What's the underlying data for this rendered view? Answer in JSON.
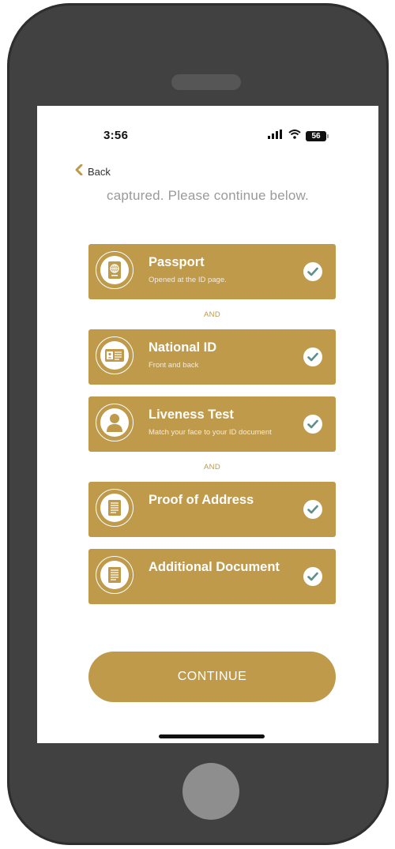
{
  "status_bar": {
    "time": "3:56",
    "battery_level": "56"
  },
  "nav": {
    "back_label": "Back"
  },
  "intro": {
    "text": "captured. Please continue below."
  },
  "documents": [
    {
      "title": "Passport",
      "subtitle": "Opened at the ID page.",
      "icon": "passport-icon",
      "completed": true
    },
    {
      "title": "National ID",
      "subtitle": "Front and back",
      "icon": "id-card-icon",
      "completed": true
    },
    {
      "title": "Liveness Test",
      "subtitle": "Match your face to your ID document",
      "icon": "person-icon",
      "completed": true
    },
    {
      "title": "Proof of Address",
      "subtitle": "",
      "icon": "document-icon",
      "completed": true
    },
    {
      "title": "Additional Document",
      "subtitle": "",
      "icon": "document-icon",
      "completed": true
    }
  ],
  "separators": [
    "AND",
    "AND"
  ],
  "continue_label": "CONTINUE",
  "colors": {
    "accent": "#be9a4a",
    "check": "#5e8f8a",
    "device_body": "#414141"
  }
}
